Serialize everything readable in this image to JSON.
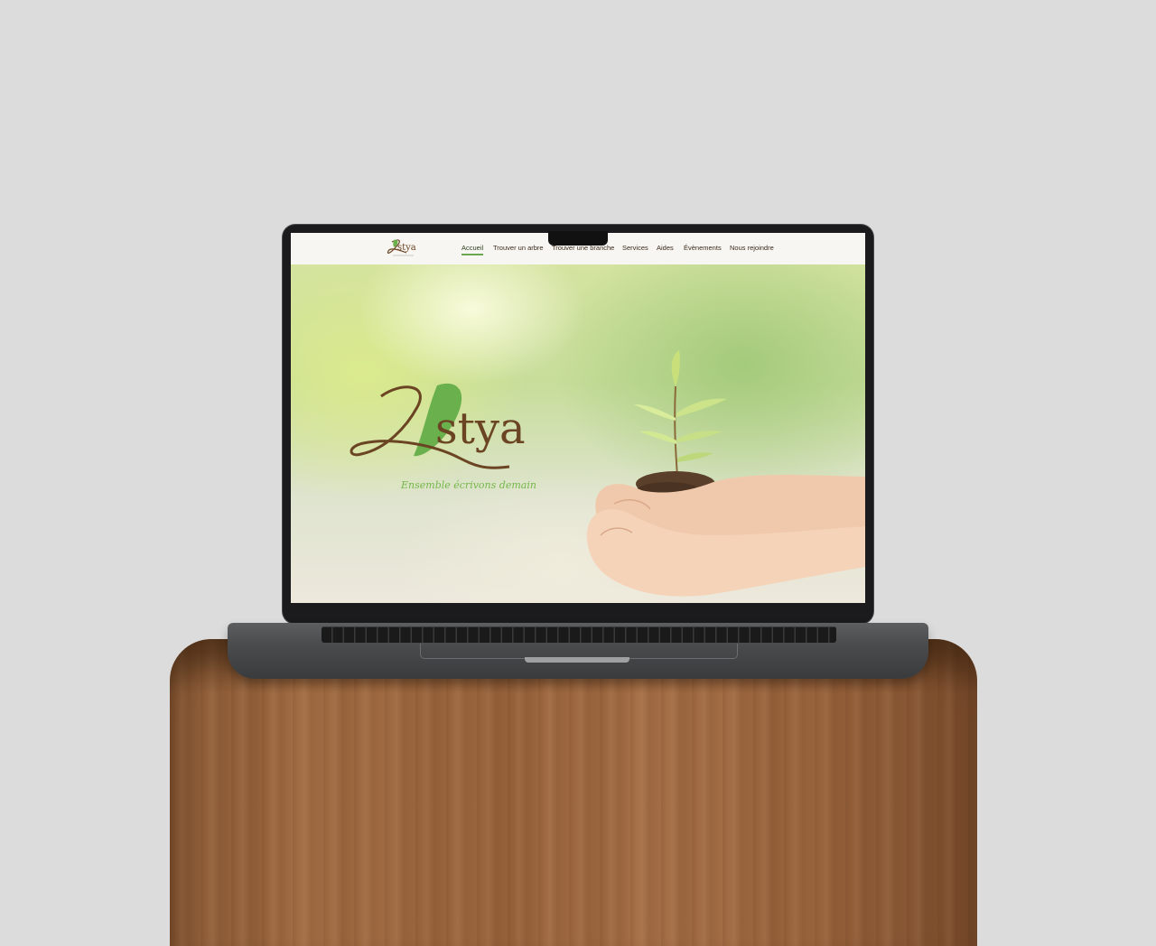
{
  "site": {
    "brand": "Lystya",
    "tagline": "Ensemble écrivons demain"
  },
  "nav": {
    "items": [
      {
        "label": "Accueil",
        "active": true
      },
      {
        "label": "Trouver un arbre",
        "active": false
      },
      {
        "label": "Trouver une branche",
        "active": false
      },
      {
        "label": "Services",
        "active": false
      },
      {
        "label": "Aides",
        "active": false
      },
      {
        "label": "Évènements",
        "active": false
      },
      {
        "label": "Nous rejoindre",
        "active": false
      }
    ]
  },
  "colors": {
    "brand_brown": "#6b4423",
    "brand_green": "#6ab04c",
    "nav_active_underline": "#6aa84f"
  },
  "icons": {
    "logo": "leaf-logo-icon",
    "hero_image": "seedling-in-hands-image"
  }
}
